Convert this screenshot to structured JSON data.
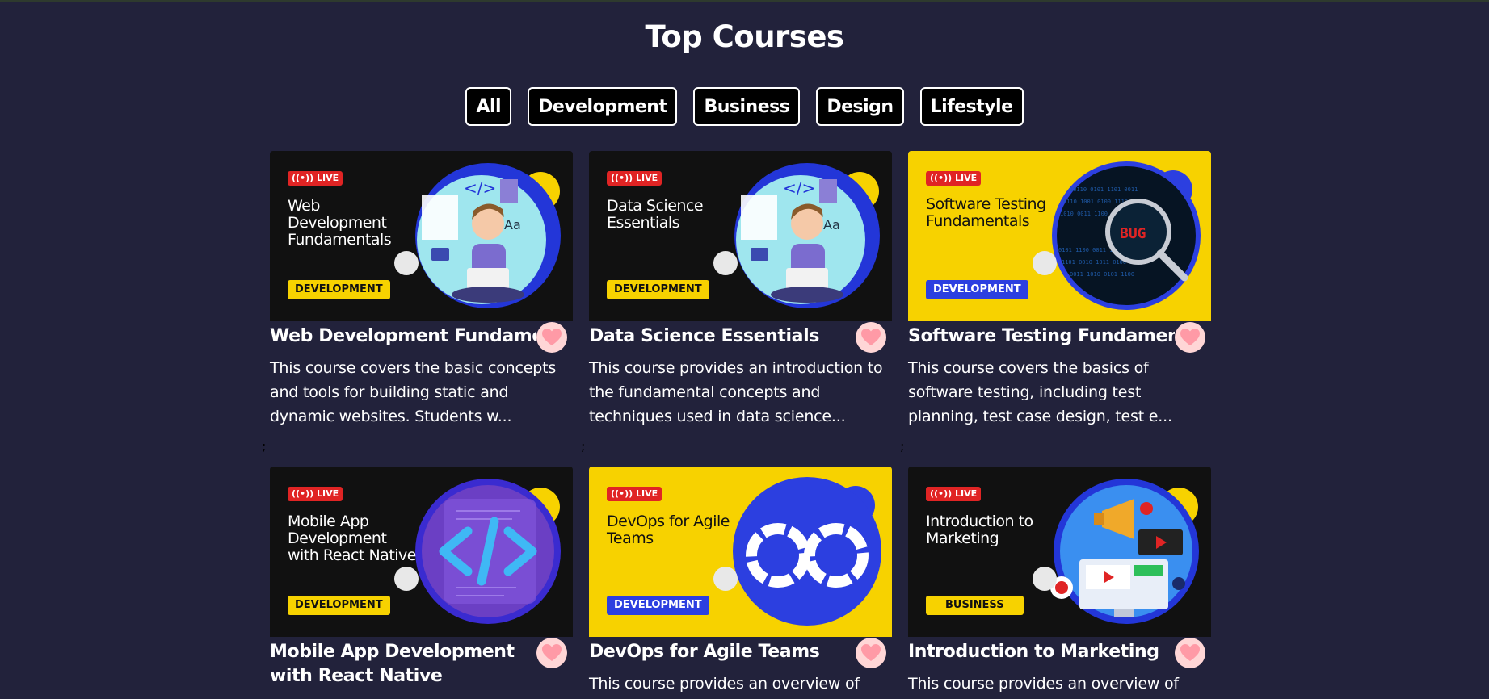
{
  "page": {
    "title": "Top Courses"
  },
  "filters": [
    "All",
    "Development",
    "Business",
    "Design",
    "Lifestyle"
  ],
  "live_label": "LIVE",
  "separator": ";",
  "courses": [
    {
      "thumb_title": "Web Development Fundamentals",
      "category": "DEVELOPMENT",
      "name": "Web Development Fundamentals",
      "description": "This course covers the basic concepts and tools for building static and dynamic websites. Students w...",
      "art": "developer-illustration"
    },
    {
      "thumb_title": "Data Science Essentials",
      "category": "DEVELOPMENT",
      "name": "Data Science Essentials",
      "description": "This course provides an introduction to the fundamental concepts and techniques used in data science...",
      "art": "developer-illustration"
    },
    {
      "thumb_title": "Software Testing Fundamentals",
      "category": "DEVELOPMENT",
      "name": "Software Testing Fundamentals",
      "description": "This course covers the basics of software testing, including test planning, test case design, test e...",
      "art": "bug-magnifier-illustration",
      "art_text": "BUG"
    },
    {
      "thumb_title": "Mobile App Development with React Native",
      "category": "DEVELOPMENT",
      "name": "Mobile App Development with React Native",
      "description": "",
      "art": "code-brackets-illustration"
    },
    {
      "thumb_title": "DevOps for Agile Teams",
      "category": "DEVELOPMENT",
      "name": "DevOps for Agile Teams",
      "description": "This course provides an overview of",
      "art": "devops-infinity-illustration"
    },
    {
      "thumb_title": "Introduction to Marketing",
      "category": "BUSINESS",
      "name": "Introduction to Marketing",
      "description": "This course provides an overview of",
      "art": "marketing-illustration"
    }
  ],
  "colors": {
    "background": "#22223b",
    "accent_yellow": "#f7d200",
    "accent_blue": "#2c3fe0",
    "live_red": "#e02424",
    "heart_bg": "#ffd6d6"
  }
}
